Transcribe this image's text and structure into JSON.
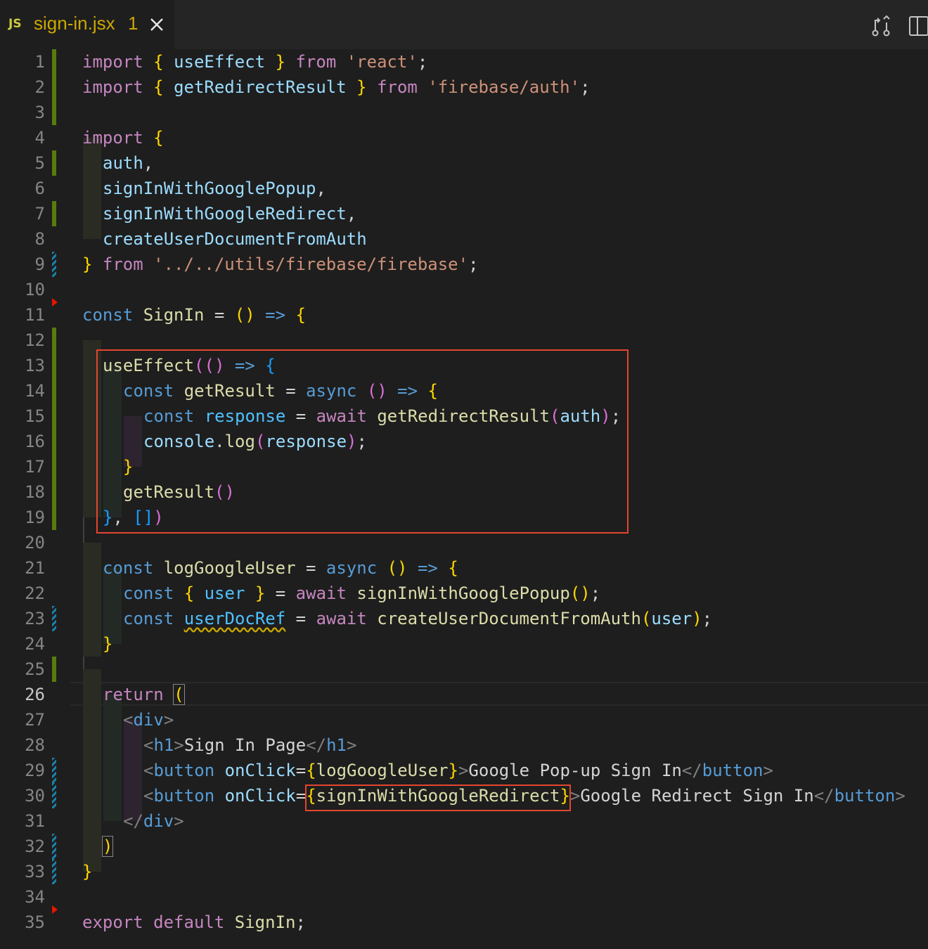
{
  "tab": {
    "icon": "JS",
    "filename": "sign-in.jsx",
    "problem_count": "1",
    "close_icon": "close-icon"
  },
  "toolbar": {
    "compare_icon": "open-changes-icon",
    "split_icon": "split-editor-icon"
  },
  "active_line": 26,
  "colors": {
    "added": "#587c0c",
    "modified": "#1b81a8",
    "deleted": "#e51400",
    "annotation": "#e2462f"
  },
  "lines": [
    {
      "n": "1",
      "text": "import { useEffect } from 'react';"
    },
    {
      "n": "2",
      "text": "import { getRedirectResult } from 'firebase/auth';"
    },
    {
      "n": "3",
      "text": ""
    },
    {
      "n": "4",
      "text": "import {"
    },
    {
      "n": "5",
      "text": "  auth,"
    },
    {
      "n": "6",
      "text": "  signInWithGooglePopup,"
    },
    {
      "n": "7",
      "text": "  signInWithGoogleRedirect,"
    },
    {
      "n": "8",
      "text": "  createUserDocumentFromAuth"
    },
    {
      "n": "9",
      "text": "} from '../../utils/firebase/firebase';"
    },
    {
      "n": "10",
      "text": ""
    },
    {
      "n": "11",
      "text": "const SignIn = () => {"
    },
    {
      "n": "12",
      "text": ""
    },
    {
      "n": "13",
      "text": "  useEffect(() => {"
    },
    {
      "n": "14",
      "text": "    const getResult = async () => {"
    },
    {
      "n": "15",
      "text": "      const response = await getRedirectResult(auth);"
    },
    {
      "n": "16",
      "text": "      console.log(response);"
    },
    {
      "n": "17",
      "text": "    }"
    },
    {
      "n": "18",
      "text": "    getResult()"
    },
    {
      "n": "19",
      "text": "  }, [])"
    },
    {
      "n": "20",
      "text": ""
    },
    {
      "n": "21",
      "text": "  const logGoogleUser = async () => {"
    },
    {
      "n": "22",
      "text": "    const { user } = await signInWithGooglePopup();"
    },
    {
      "n": "23",
      "text": "    const userDocRef = await createUserDocumentFromAuth(user);"
    },
    {
      "n": "24",
      "text": "  }"
    },
    {
      "n": "25",
      "text": ""
    },
    {
      "n": "26",
      "text": "  return ("
    },
    {
      "n": "27",
      "text": "    <div>"
    },
    {
      "n": "28",
      "text": "      <h1>Sign In Page</h1>"
    },
    {
      "n": "29",
      "text": "      <button onClick={logGoogleUser}>Google Pop-up Sign In</button>"
    },
    {
      "n": "30",
      "text": "      <button onClick={signInWithGoogleRedirect}>Google Redirect Sign In</button>"
    },
    {
      "n": "31",
      "text": "    </div>"
    },
    {
      "n": "32",
      "text": "  )"
    },
    {
      "n": "33",
      "text": "}"
    },
    {
      "n": "34",
      "text": ""
    },
    {
      "n": "35",
      "text": "export default SignIn;"
    }
  ],
  "gutter": {
    "1": "added",
    "2": "added",
    "3": "added",
    "5": "added",
    "7": "added",
    "9": "modified",
    "11": "deleted",
    "12": "added",
    "13": "added",
    "14": "added",
    "15": "added",
    "16": "added",
    "17": "added",
    "18": "added",
    "19": "added",
    "23": "modified",
    "25": "added",
    "29": "modified",
    "30": "modified",
    "32": "modified",
    "33": "modified",
    "35": "deleted"
  }
}
